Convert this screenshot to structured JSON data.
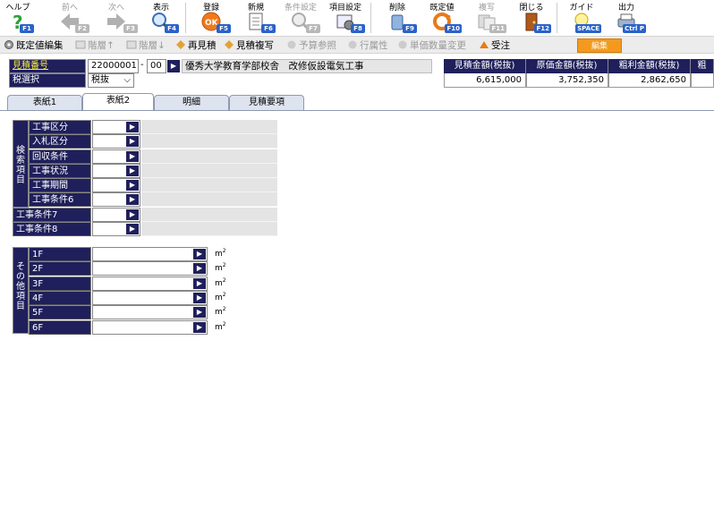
{
  "toolbar": {
    "help": "ヘルプ",
    "prev": "前へ",
    "next": "次へ",
    "show": "表示",
    "register": "登録",
    "new": "新規",
    "condition": "条件設定",
    "itemset": "項目設定",
    "delete": "削除",
    "default": "既定値",
    "copy": "複写",
    "close": "閉じる",
    "guide": "ガイド",
    "output": "出力",
    "keys": {
      "help": "F1",
      "prev": "F2",
      "next": "F3",
      "show": "F4",
      "register": "F5",
      "new": "F6",
      "condition": "F7",
      "itemset": "F8",
      "delete": "F9",
      "default": "F10",
      "copy": "F11",
      "close": "F12",
      "guide": "SPACE",
      "output": "Ctrl P"
    }
  },
  "row2": {
    "default_edit": "既定値編集",
    "level_up": "階層↑",
    "level_down": "階層↓",
    "reestimate": "再見積",
    "estimate_copy": "見積複写",
    "budget_ref": "予算参照",
    "row_attr": "行属性",
    "unit_qty": "単価数量変更",
    "order": "受注",
    "edit": "編集"
  },
  "header": {
    "estimate_no_label": "見積番号",
    "estimate_no": "22000001",
    "dash": "-",
    "branch": "00",
    "project_name": "優秀大学教育学部校舎　改修仮設電気工事",
    "tax_label": "税選択",
    "tax_value": "税抜",
    "tax_arrow": "⌵"
  },
  "summary": {
    "headers": [
      "見積金額(税抜)",
      "原価金額(税抜)",
      "粗利金額(税抜)",
      "粗"
    ],
    "values": [
      "6,615,000",
      "3,752,350",
      "2,862,650",
      ""
    ]
  },
  "tabs": [
    "表紙1",
    "表紙2",
    "明細",
    "見積要項"
  ],
  "search_section": {
    "side_label": [
      "検",
      "索",
      "項",
      "目"
    ],
    "fields": [
      "工事区分",
      "入札区分",
      "回収条件",
      "工事状況",
      "工事期間",
      "工事条件6",
      "工事条件7",
      "工事条件8"
    ]
  },
  "other_section": {
    "side_label": [
      "そ",
      "の",
      "他",
      "項",
      "目"
    ],
    "floors": [
      "1F",
      "2F",
      "3F",
      "4F",
      "5F",
      "6F"
    ],
    "unit": "m",
    "unit_sup": "2"
  },
  "colors": {
    "label_bg": "#1f1f5c",
    "fkey_bg": "#2a62c9",
    "edit_orange": "#f39a1e"
  }
}
